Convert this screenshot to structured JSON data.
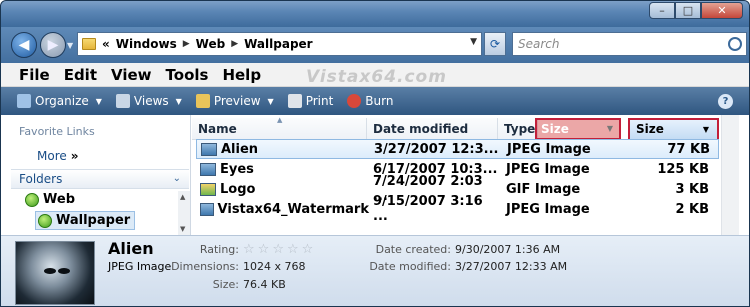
{
  "address": {
    "overflow": "«",
    "crumbs": [
      "Windows",
      "Web",
      "Wallpaper"
    ]
  },
  "search": {
    "placeholder": "Search"
  },
  "menu": [
    "File",
    "Edit",
    "View",
    "Tools",
    "Help"
  ],
  "watermark": "Vistax64.com",
  "commands": [
    {
      "label": "Organize",
      "icon": "organize-icon"
    },
    {
      "label": "Views",
      "icon": "views-icon"
    },
    {
      "label": "Preview",
      "icon": "preview-icon"
    },
    {
      "label": "Print",
      "icon": "print-icon"
    },
    {
      "label": "Burn",
      "icon": "burn-icon"
    }
  ],
  "nav": {
    "favorite_links": "Favorite Links",
    "more": "More",
    "more_arrows": "»",
    "folders": "Folders",
    "tree": [
      "Web",
      "Wallpaper"
    ]
  },
  "columns": {
    "name": "Name",
    "date": "Date modified",
    "type": "Type",
    "ghost": "Size",
    "size": "Size"
  },
  "files": [
    {
      "name": "Alien",
      "date": "3/27/2007 12:3...",
      "type": "JPEG Image",
      "size": "77 KB",
      "selected": true
    },
    {
      "name": "Eyes",
      "date": "6/17/2007 10:3...",
      "type": "JPEG Image",
      "size": "125 KB"
    },
    {
      "name": "Logo",
      "date": "7/24/2007 2:03 ...",
      "type": "GIF Image",
      "size": "3 KB"
    },
    {
      "name": "Vistax64_Watermark",
      "date": "9/15/2007 3:16 ...",
      "type": "JPEG Image",
      "size": "2 KB"
    }
  ],
  "details": {
    "name": "Alien",
    "type": "JPEG Image",
    "rating_label": "Rating:",
    "rating": 0,
    "dimensions_label": "Dimensions:",
    "dimensions": "1024 x 768",
    "size_label": "Size:",
    "size": "76.4 KB",
    "created_label": "Date created:",
    "created": "9/30/2007 1:36 AM",
    "modified_label": "Date modified:",
    "modified": "3/27/2007 12:33 AM"
  },
  "colors": {
    "highlight_border": "#c21f3a",
    "selection": "#dcecfb"
  }
}
